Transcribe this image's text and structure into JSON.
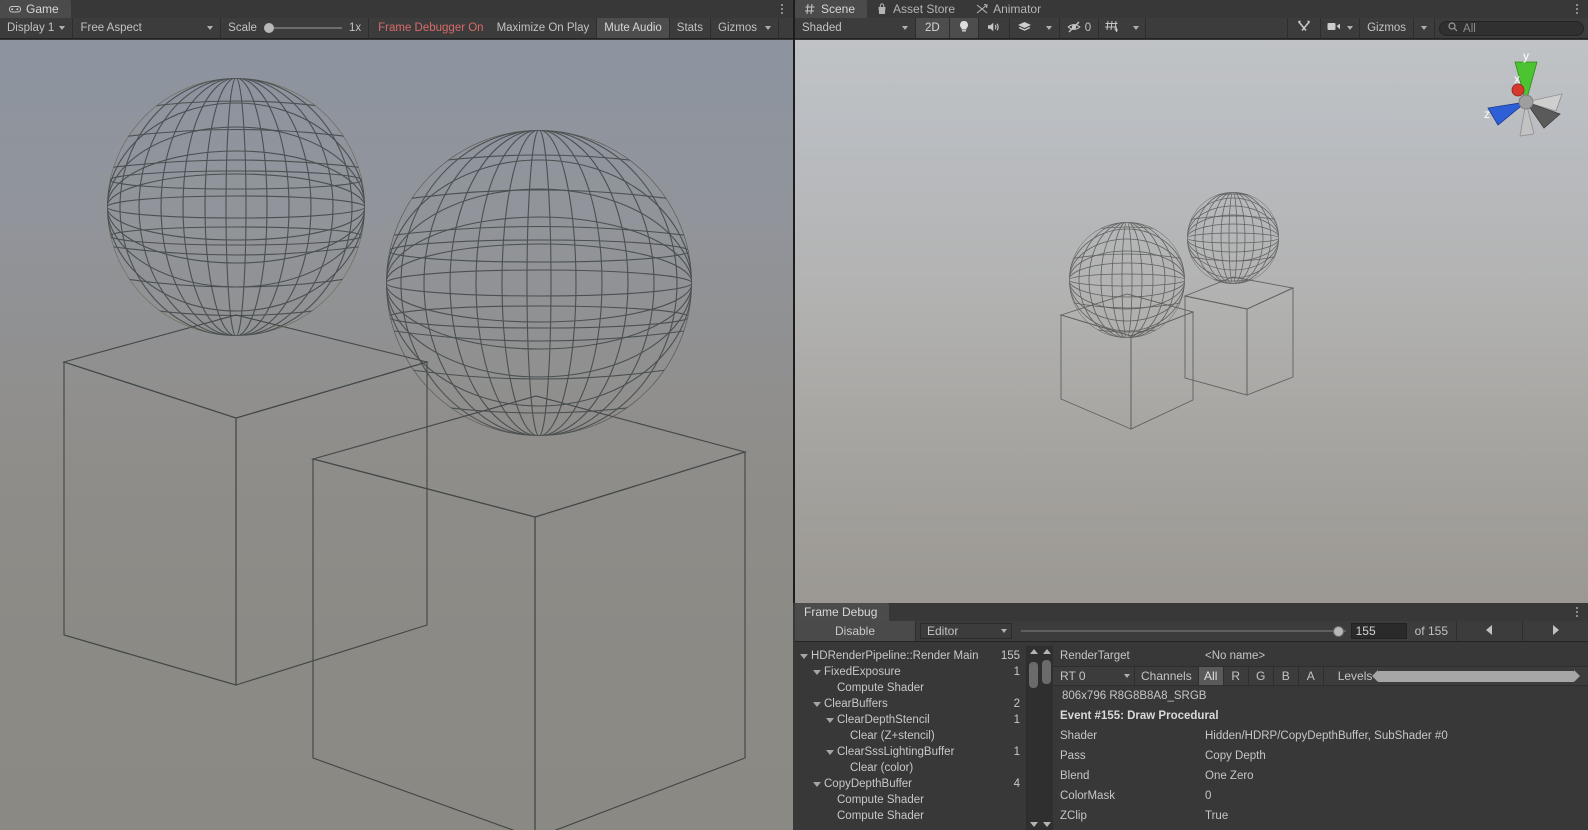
{
  "game_panel": {
    "tabs": [
      {
        "label": "Game",
        "icon": "gamepad-icon",
        "active": true
      }
    ],
    "toolbar": {
      "display": "Display 1",
      "aspect": "Free Aspect",
      "scale_label": "Scale",
      "scale_value": "1x",
      "frame_debugger": "Frame Debugger On",
      "maximize": "Maximize On Play",
      "mute_audio": "Mute Audio",
      "stats": "Stats",
      "gizmos": "Gizmos"
    },
    "scene_objects": {
      "spheres": 2,
      "cubes": 2,
      "render_mode": "wireframe"
    }
  },
  "scene_panel": {
    "tabs": [
      {
        "label": "Scene",
        "icon": "grid-hash-icon",
        "active": true
      },
      {
        "label": "Asset Store",
        "icon": "shopping-bag-icon",
        "active": false
      },
      {
        "label": "Animator",
        "icon": "animator-icon",
        "active": false
      }
    ],
    "toolbar": {
      "draw_mode": "Shaded",
      "two_d": "2D",
      "lighting_icon": "lightbulb-icon",
      "audio_icon": "speaker-icon",
      "effects_icon": "effects-icon",
      "hidden_count": "0",
      "grid_icon": "grid-visibility-icon",
      "tools_icon": "scene-tools-icon",
      "camera_icon": "scene-camera-icon",
      "gizmos": "Gizmos",
      "search_placeholder": "All"
    },
    "gizmo": {
      "x_label": "x",
      "y_label": "y",
      "z_label": "z",
      "projection": "Persp",
      "x_color": "#d63a2f",
      "y_color": "#4cc432",
      "z_color": "#2f5fd6"
    },
    "scene_objects": {
      "spheres": 2,
      "cubes": 2,
      "render_mode": "wireframe"
    }
  },
  "frame_debug": {
    "tabs": [
      {
        "label": "Frame Debug",
        "active": true
      }
    ],
    "toolbar": {
      "disable_label": "Disable",
      "target_select": "Editor",
      "event_number": "155",
      "of_label": "of 155",
      "prev_icon": "prev-arrow-icon",
      "next_icon": "next-arrow-icon"
    },
    "tree": [
      {
        "label": "HDRenderPipeline::Render Main",
        "count": "155",
        "depth": 0,
        "expandable": true
      },
      {
        "label": "FixedExposure",
        "count": "1",
        "depth": 1,
        "expandable": true
      },
      {
        "label": "Compute Shader",
        "count": "",
        "depth": 2,
        "expandable": false
      },
      {
        "label": "ClearBuffers",
        "count": "2",
        "depth": 1,
        "expandable": true
      },
      {
        "label": "ClearDepthStencil",
        "count": "1",
        "depth": 2,
        "expandable": true
      },
      {
        "label": "Clear (Z+stencil)",
        "count": "",
        "depth": 3,
        "expandable": false
      },
      {
        "label": "ClearSssLightingBuffer",
        "count": "1",
        "depth": 2,
        "expandable": true
      },
      {
        "label": "Clear (color)",
        "count": "",
        "depth": 3,
        "expandable": false
      },
      {
        "label": "CopyDepthBuffer",
        "count": "4",
        "depth": 1,
        "expandable": true
      },
      {
        "label": "Compute Shader",
        "count": "",
        "depth": 2,
        "expandable": false
      },
      {
        "label": "Compute Shader",
        "count": "",
        "depth": 2,
        "expandable": false
      }
    ],
    "detail": {
      "render_target_label": "RenderTarget",
      "render_target_value": "<No name>",
      "rt_select": "RT 0",
      "channels_label": "Channels",
      "channels": [
        "All",
        "R",
        "G",
        "B",
        "A"
      ],
      "channel_active": "All",
      "levels_label": "Levels",
      "format": "806x796 R8G8B8A8_SRGB",
      "event_title": "Event #155: Draw Procedural",
      "properties": [
        {
          "key": "Shader",
          "value": "Hidden/HDRP/CopyDepthBuffer, SubShader #0"
        },
        {
          "key": "Pass",
          "value": "Copy Depth"
        },
        {
          "key": "Blend",
          "value": "One Zero"
        },
        {
          "key": "ColorMask",
          "value": "0"
        },
        {
          "key": "ZClip",
          "value": "True"
        }
      ]
    }
  }
}
